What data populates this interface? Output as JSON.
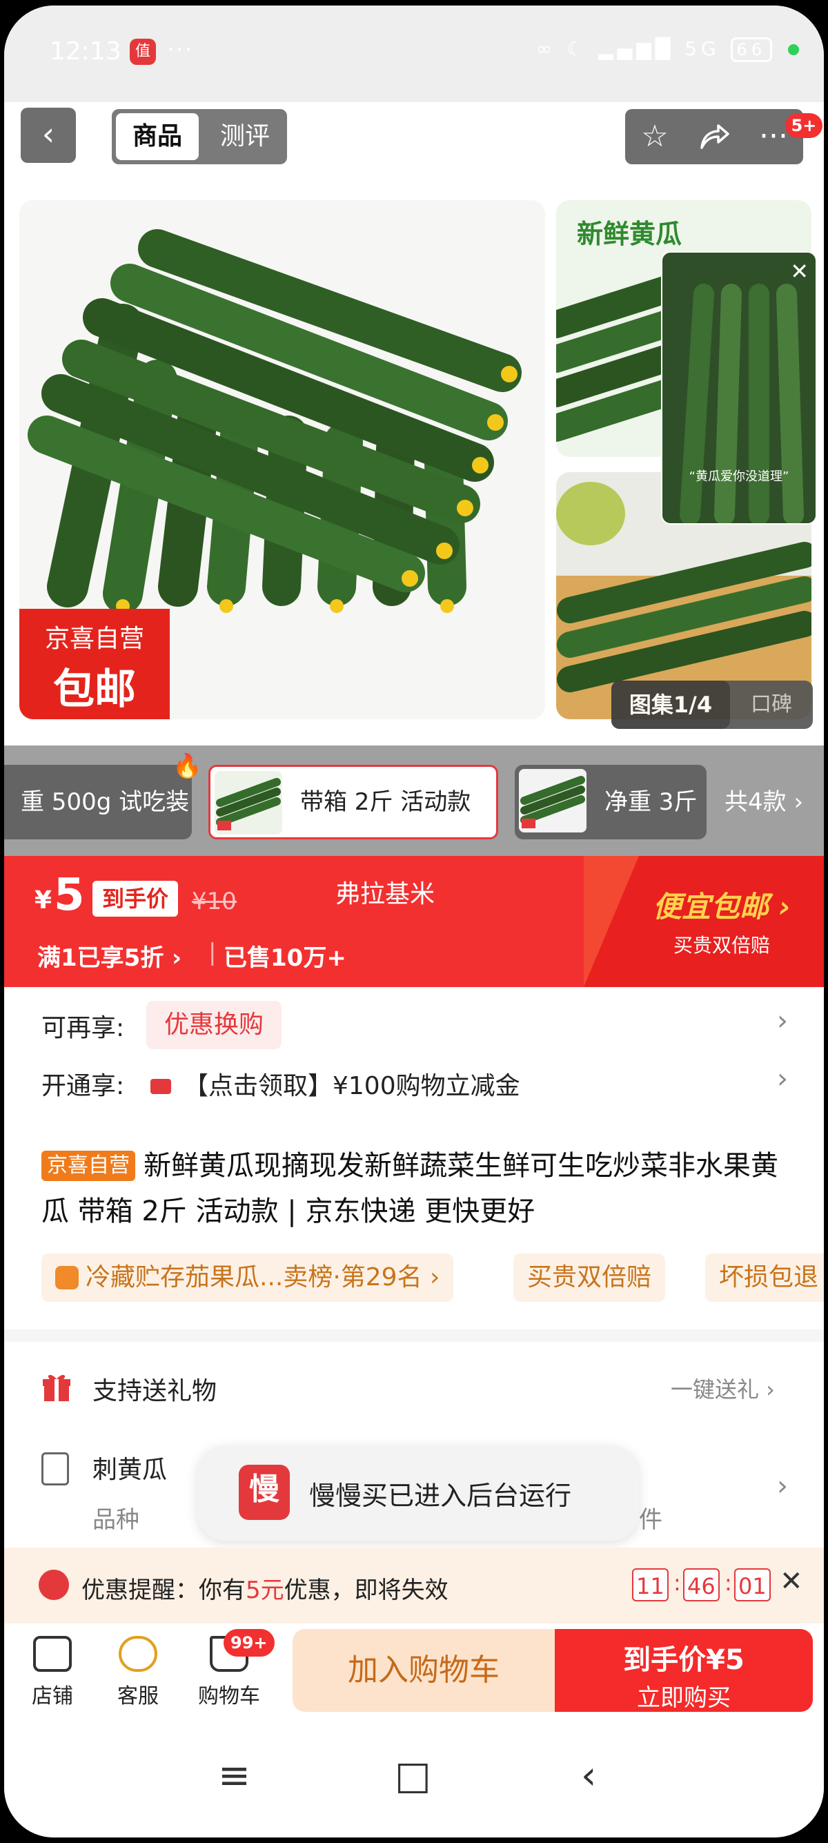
{
  "status_bar": {
    "time": "12:13",
    "overflow": "···",
    "battery": "66",
    "network": "5G"
  },
  "header": {
    "tabs": [
      "商品",
      "测评"
    ],
    "more_badge": "5+"
  },
  "gallery": {
    "promo_line1": "京喜自营",
    "promo_line2": "包邮",
    "side_title": "新鲜黄瓜",
    "video_caption": "“黄瓜爱你没道理”",
    "gallery_label": "图集1/4",
    "reviews_label": "口碑"
  },
  "variants": {
    "items": [
      "重 500g 试吃装",
      "带箱 2斤 活动款",
      "净重 3斤"
    ],
    "count_label": "共4款"
  },
  "price_banner": {
    "currency": "¥",
    "price": "5",
    "price_tag": "到手价",
    "original_price": "¥10",
    "brand": "弗拉基米",
    "deal": "满1已享5折 ›",
    "sold": "已售10万+",
    "freeship_title": "便宜包邮 ›",
    "freeship_sub": "买贵双倍赔"
  },
  "offers": {
    "row1_label": "可再享:",
    "row1_value": "优惠换购",
    "row2_label": "开通享:",
    "row2_value": "【点击领取】¥100购物立减金"
  },
  "product": {
    "self_tag": "京喜自营",
    "title": "新鲜黄瓜现摘现发新鲜蔬菜生鲜可生吃炒菜非水果黄瓜 带箱 2斤 活动款 | 京东快递 更快更好",
    "chips": [
      "冷藏贮存茄果瓜...卖榜·第29名 ›",
      "买贵双倍赔",
      "坏损包退"
    ]
  },
  "services": {
    "gift_label": "支持送礼物",
    "gift_action": "一键送礼 ›",
    "variety_value": "刺黄瓜",
    "variety_label": "品种",
    "condition_tail": "件"
  },
  "toast": {
    "icon_text": "慢",
    "message": "慢慢买已进入后台运行"
  },
  "reminder": {
    "prefix": "优惠提醒：你有",
    "amount": "5元",
    "suffix": "优惠，即将失效",
    "hours": "11",
    "minutes": "46",
    "seconds": "01"
  },
  "bottom_bar": {
    "store": "店铺",
    "service": "客服",
    "cart": "购物车",
    "cart_badge": "99+",
    "add_to_cart": "加入购物车",
    "buy_price": "到手价¥5",
    "buy_now": "立即购买"
  },
  "colors": {
    "brand_red": "#f23030",
    "orange": "#f07b1a",
    "cucumber_green": "#2f5a25"
  }
}
